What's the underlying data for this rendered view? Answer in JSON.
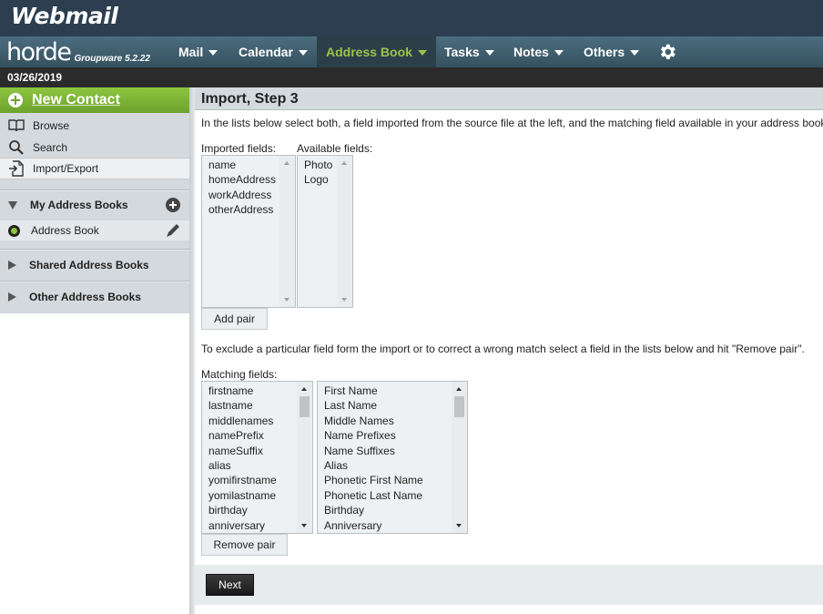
{
  "topbar": {
    "logo": "Webmail"
  },
  "navbar": {
    "brand": "horde",
    "version": "Groupware 5.2.22",
    "items": [
      {
        "label": "Mail"
      },
      {
        "label": "Calendar"
      },
      {
        "label": "Address Book"
      },
      {
        "label": "Tasks"
      },
      {
        "label": "Notes"
      },
      {
        "label": "Others"
      }
    ],
    "active_color": "#9bc34b"
  },
  "datebar": {
    "date": "03/26/2019"
  },
  "sidebar": {
    "new_contact": "New Contact",
    "links": [
      {
        "label": "Browse",
        "icon": "book-icon"
      },
      {
        "label": "Search",
        "icon": "search-icon"
      },
      {
        "label": "Import/Export",
        "icon": "import-export-icon"
      }
    ],
    "my_address_books": "My Address Books",
    "address_book": "Address Book",
    "shared_address_books": "Shared Address Books",
    "other_address_books": "Other Address Books",
    "accent_color": "#8dc63f"
  },
  "main": {
    "title": "Import, Step 3",
    "intro": "In the lists below select both, a field imported from the source file at the left, and the matching field available in your address book",
    "imported_label": "Imported fields:",
    "available_label": "Available fields:",
    "imported_fields": [
      "name",
      "homeAddress",
      "workAddress",
      "otherAddress"
    ],
    "available_fields": [
      "Photo",
      "Logo"
    ],
    "add_pair": "Add pair",
    "exclude_text": "To exclude a particular field form the import or to correct a wrong match select a field in the lists below and hit \"Remove pair\".",
    "matching_label": "Matching fields:",
    "matching_source": [
      "firstname",
      "lastname",
      "middlenames",
      "namePrefix",
      "nameSuffix",
      "alias",
      "yomifirstname",
      "yomilastname",
      "birthday",
      "anniversary"
    ],
    "matching_target": [
      "First Name",
      "Last Name",
      "Middle Names",
      "Name Prefixes",
      "Name Suffixes",
      "Alias",
      "Phonetic First Name",
      "Phonetic Last Name",
      "Birthday",
      "Anniversary"
    ],
    "remove_pair": "Remove pair",
    "next": "Next"
  }
}
